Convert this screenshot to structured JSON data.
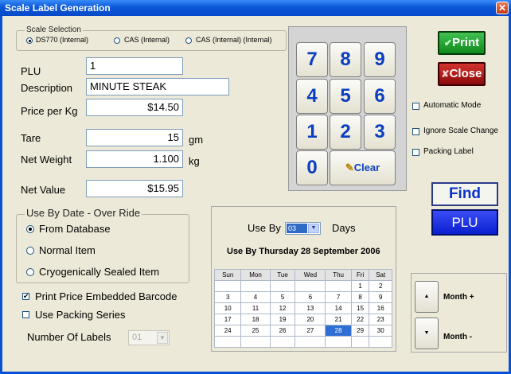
{
  "window": {
    "title": "Scale Label Generation",
    "close_glyph": "✕"
  },
  "scale_selection": {
    "label": "Scale Selection",
    "options": [
      "DS770 (Internal)",
      "CAS (Internal)",
      "CAS (Internal) (Internal)"
    ],
    "selected": 0
  },
  "fields": {
    "plu_label": "PLU",
    "plu_value": "1",
    "description_label": "Description",
    "description_value": "MINUTE STEAK",
    "price_label": "Price per Kg",
    "price_value": "$14.50",
    "tare_label": "Tare",
    "tare_value": "15",
    "tare_unit": "gm",
    "netweight_label": "Net Weight",
    "netweight_value": "1.100",
    "netweight_unit": "kg",
    "netvalue_label": "Net Value",
    "netvalue_value": "$15.95"
  },
  "keypad": {
    "keys": [
      "7",
      "8",
      "9",
      "4",
      "5",
      "6",
      "1",
      "2",
      "3",
      "0"
    ],
    "clear_label": "Clear"
  },
  "buttons": {
    "print": "Print",
    "close": "Close",
    "find": "Find",
    "plu": "PLU",
    "month_plus": "Month +",
    "month_minus": "Month -",
    "up_glyph": "▲",
    "down_glyph": "▼"
  },
  "options": {
    "automatic_mode": "Automatic Mode",
    "ignore_scale_change": "Ignore Scale Change",
    "packing_label": "Packing Label"
  },
  "use_by_override": {
    "label": "Use By Date - Over Ride",
    "options": [
      "From Database",
      "Normal Item",
      "Cryogenically Sealed Item"
    ],
    "selected": 0
  },
  "barcode": {
    "print_embedded_label": "Print Price Embedded Barcode",
    "print_embedded_checked": true,
    "packing_series_label": "Use Packing Series",
    "packing_series_checked": false
  },
  "labels_count": {
    "label": "Number Of Labels",
    "value": "01"
  },
  "use_by": {
    "label": "Use By",
    "value": "03",
    "unit": "Days",
    "summary": "Use By Thursday 28 September 2006"
  },
  "calendar": {
    "days": [
      "Sun",
      "Mon",
      "Tue",
      "Wed",
      "Thu",
      "Fri",
      "Sat"
    ],
    "weeks": [
      [
        "",
        "",
        "",
        "",
        "",
        "1",
        "2"
      ],
      [
        "3",
        "4",
        "5",
        "6",
        "7",
        "8",
        "9"
      ],
      [
        "10",
        "11",
        "12",
        "13",
        "14",
        "15",
        "16"
      ],
      [
        "17",
        "18",
        "19",
        "20",
        "21",
        "22",
        "23"
      ],
      [
        "24",
        "25",
        "26",
        "27",
        "28",
        "29",
        "30"
      ],
      [
        "",
        "",
        "",
        "",
        "",
        "",
        ""
      ]
    ],
    "selected": "28"
  },
  "colors": {
    "title_bar": "#0A58D8",
    "print_button": "#0E8A1A",
    "close_button": "#9E0E0E",
    "plu_button": "#0A1FD0",
    "key_text": "#0B3FBF"
  }
}
